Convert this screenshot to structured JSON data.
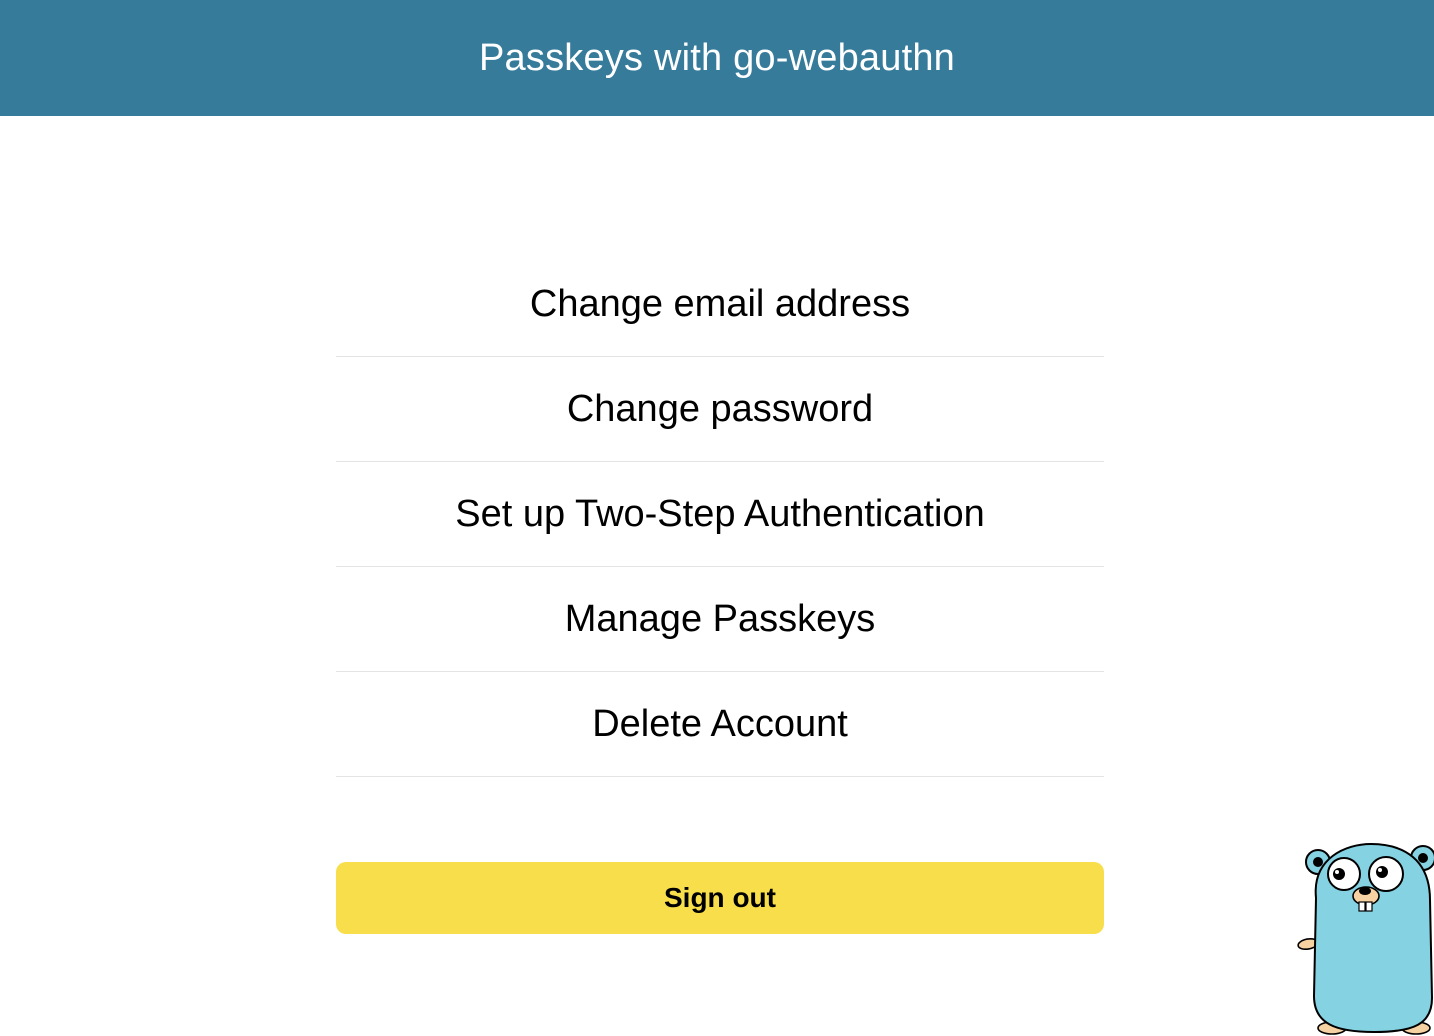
{
  "header": {
    "title": "Passkeys with go-webauthn"
  },
  "menu": {
    "items": [
      {
        "label": "Change email address"
      },
      {
        "label": "Change password"
      },
      {
        "label": "Set up Two-Step Authentication"
      },
      {
        "label": "Manage Passkeys"
      },
      {
        "label": "Delete Account"
      }
    ]
  },
  "actions": {
    "sign_out_label": "Sign out"
  },
  "colors": {
    "header_bg": "#377b9b",
    "button_bg": "#f8de4b",
    "divider": "#e3e3e3",
    "gopher_body": "#84d2e2"
  },
  "mascot": {
    "icon": "gopher-mascot-icon"
  }
}
